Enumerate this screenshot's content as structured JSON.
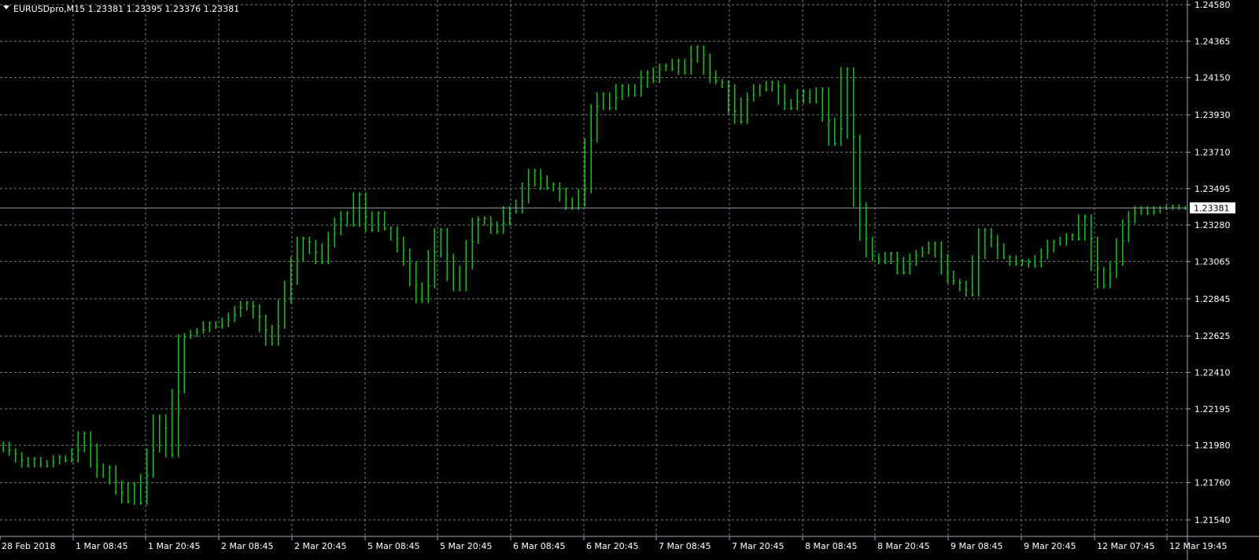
{
  "header": {
    "symbol_line": "EURUSDpro,M15  1.23381 1.23395 1.23376 1.23381"
  },
  "colors": {
    "background": "#000000",
    "grid": "#6b7b8c",
    "bars": "#00cc00",
    "axis_text": "#ffffff",
    "price_line": "#8d9aa8",
    "price_box_bg": "#ffffff",
    "price_box_text": "#000000"
  },
  "current_price": {
    "value": 1.23381,
    "label": "1.23381"
  },
  "chart_data": {
    "type": "line",
    "title": "",
    "xlabel": "",
    "ylabel": "",
    "ylim": [
      1.2154,
      1.2458
    ],
    "grid": true,
    "y_ticks": [
      "1.24580",
      "1.24365",
      "1.24150",
      "1.23930",
      "1.23710",
      "1.23495",
      "1.23280",
      "1.23065",
      "1.22845",
      "1.22625",
      "1.22410",
      "1.22195",
      "1.21980",
      "1.21760",
      "1.21540"
    ],
    "x_ticks": [
      "28 Feb 2018",
      "1 Mar 08:45",
      "1 Mar 20:45",
      "2 Mar 08:45",
      "2 Mar 20:45",
      "5 Mar 08:45",
      "5 Mar 20:45",
      "6 Mar 08:45",
      "6 Mar 20:45",
      "7 Mar 08:45",
      "7 Mar 20:45",
      "8 Mar 08:45",
      "8 Mar 20:45",
      "9 Mar 08:45",
      "9 Mar 20:45",
      "12 Mar 07:45",
      "12 Mar 19:45"
    ],
    "series": [
      {
        "values": [
          1.2199,
          1.2195,
          1.2193,
          1.2189,
          1.2186,
          1.219,
          1.2187,
          1.2186,
          1.2188,
          1.2191,
          1.2189,
          1.2189,
          1.2195,
          1.2205,
          1.2198,
          1.2186,
          1.218,
          1.2185,
          1.2176,
          1.217,
          1.2165,
          1.2175,
          1.2164,
          1.218,
          1.2195,
          1.2215,
          1.2208,
          1.2192,
          1.223,
          1.2262,
          1.2263,
          1.2265,
          1.2266,
          1.227,
          1.2268,
          1.2269,
          1.2272,
          1.2275,
          1.2279,
          1.2282,
          1.228,
          1.2274,
          1.2266,
          1.2258,
          1.2268,
          1.2283,
          1.2294,
          1.2308,
          1.232,
          1.2318,
          1.2312,
          1.2306,
          1.2316,
          1.2323,
          1.2331,
          1.2335,
          1.2328,
          1.2346,
          1.2333,
          1.2325,
          1.2335,
          1.2326,
          1.2326,
          1.232,
          1.2313,
          1.2305,
          1.2293,
          1.2283,
          1.2292,
          1.2312,
          1.2325,
          1.231,
          1.2296,
          1.229,
          1.2303,
          1.2318,
          1.2331,
          1.2332,
          1.2329,
          1.2324,
          1.2329,
          1.2338,
          1.2336,
          1.2342,
          1.2352,
          1.236,
          1.2356,
          1.235,
          1.2352,
          1.2349,
          1.2343,
          1.2338,
          1.234,
          1.2348,
          1.2378,
          1.2398,
          1.2405,
          1.2397,
          1.2403,
          1.241,
          1.2408,
          1.2405,
          1.241,
          1.2418,
          1.2413,
          1.242,
          1.2422,
          1.242,
          1.2425,
          1.2418,
          1.2425,
          1.2433,
          1.2428,
          1.2418,
          1.2413,
          1.2412,
          1.241,
          1.2395,
          1.2389,
          1.2402,
          1.2405,
          1.241,
          1.2408,
          1.2412,
          1.241,
          1.24,
          1.2397,
          1.2401,
          1.2407,
          1.2403,
          1.2401,
          1.2408,
          1.239,
          1.2376,
          1.2385,
          1.242,
          1.238,
          1.234,
          1.232,
          1.231,
          1.2308,
          1.2306,
          1.2311,
          1.2308,
          1.23,
          1.2305,
          1.231,
          1.2312,
          1.2314,
          1.2317,
          1.231,
          1.23,
          1.2295,
          1.2294,
          1.229,
          1.2287,
          1.2309,
          1.2325,
          1.2321,
          1.2316,
          1.2309,
          1.2309,
          1.2305,
          1.2307,
          1.2306,
          1.2304,
          1.2309,
          1.2313,
          1.2318,
          1.2317,
          1.232,
          1.2322,
          1.232,
          1.2333,
          1.232,
          1.2302,
          1.2292,
          1.2298,
          1.2305,
          1.2319,
          1.233,
          1.2335,
          1.2338,
          1.2335,
          1.2336,
          1.2338,
          1.2338,
          1.2339,
          1.2338,
          1.2338
        ]
      }
    ]
  }
}
